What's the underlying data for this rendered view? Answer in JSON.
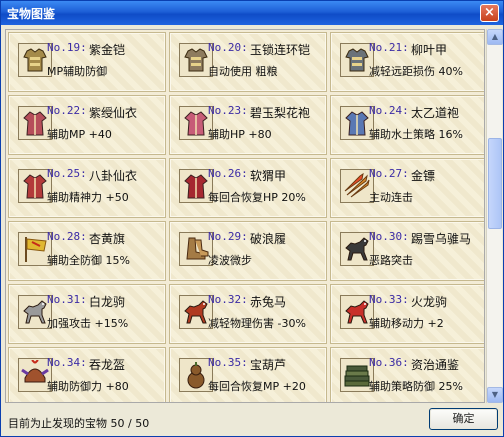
{
  "window": {
    "title": "宝物图鉴",
    "close_label": "×"
  },
  "items": [
    {
      "num": "No.19:",
      "name": "紫金铠",
      "desc": "MP辅助防御",
      "icon": "armor-icon",
      "color": "#a48a4a"
    },
    {
      "num": "No.20:",
      "name": "玉锁连环铠",
      "desc": "自动使用 粗粮",
      "icon": "armor-icon",
      "color": "#8d7b5e"
    },
    {
      "num": "No.21:",
      "name": "柳叶甲",
      "desc": "减轻远距损伤 40%",
      "icon": "armor-icon",
      "color": "#6a7279"
    },
    {
      "num": "No.22:",
      "name": "紫绶仙衣",
      "desc": "辅助MP +40",
      "icon": "robe-icon",
      "color": "#b64e5a"
    },
    {
      "num": "No.23:",
      "name": "碧玉梨花袍",
      "desc": "辅助HP +80",
      "icon": "robe-icon",
      "color": "#c75c77"
    },
    {
      "num": "No.24:",
      "name": "太乙道袍",
      "desc": "辅助水土策略 16%",
      "icon": "robe-icon",
      "color": "#5a78b3"
    },
    {
      "num": "No.25:",
      "name": "八卦仙衣",
      "desc": "辅助精神力 +50",
      "icon": "robe-icon",
      "color": "#b33a3a"
    },
    {
      "num": "No.26:",
      "name": "软猬甲",
      "desc": "每回合恢复HP 20%",
      "icon": "robe-icon",
      "color": "#a52830"
    },
    {
      "num": "No.27:",
      "name": "金镖",
      "desc": "主动连击",
      "icon": "dart-icon",
      "color": "#d88a2a"
    },
    {
      "num": "No.28:",
      "name": "杏黄旗",
      "desc": "辅助全防御 15%",
      "icon": "flag-icon",
      "color": "#e0b830"
    },
    {
      "num": "No.29:",
      "name": "破浪履",
      "desc": "凌波微步",
      "icon": "boots-icon",
      "color": "#a47b45"
    },
    {
      "num": "No.30:",
      "name": "踢雪乌骓马",
      "desc": "恶路突击",
      "icon": "horse-icon",
      "color": "#3a3a3a"
    },
    {
      "num": "No.31:",
      "name": "白龙驹",
      "desc": "加强攻击 +15%",
      "icon": "horse-icon",
      "color": "#9a9a9a"
    },
    {
      "num": "No.32:",
      "name": "赤兔马",
      "desc": "减轻物理伤害 -30%",
      "icon": "horse-icon",
      "color": "#b03a20"
    },
    {
      "num": "No.33:",
      "name": "火龙驹",
      "desc": "辅助移动力 +2",
      "icon": "horse-icon",
      "color": "#c8302a"
    },
    {
      "num": "No.34:",
      "name": "吞龙盔",
      "desc": "辅助防御力 +80",
      "icon": "helmet-icon",
      "color": "#a0522d"
    },
    {
      "num": "No.35:",
      "name": "宝葫芦",
      "desc": "每回合恢复MP +20",
      "icon": "gourd-icon",
      "color": "#8a5a2b"
    },
    {
      "num": "No.36:",
      "name": "资治通鉴",
      "desc": "辅助策略防御 25%",
      "icon": "book-icon",
      "color": "#4a5a3a"
    }
  ],
  "status_text": "目前为止发现的宝物 50 / 50",
  "ok_label": "确定",
  "scrollbar": {
    "up_glyph": "▲",
    "down_glyph": "▼",
    "position_fraction": 0.37
  }
}
